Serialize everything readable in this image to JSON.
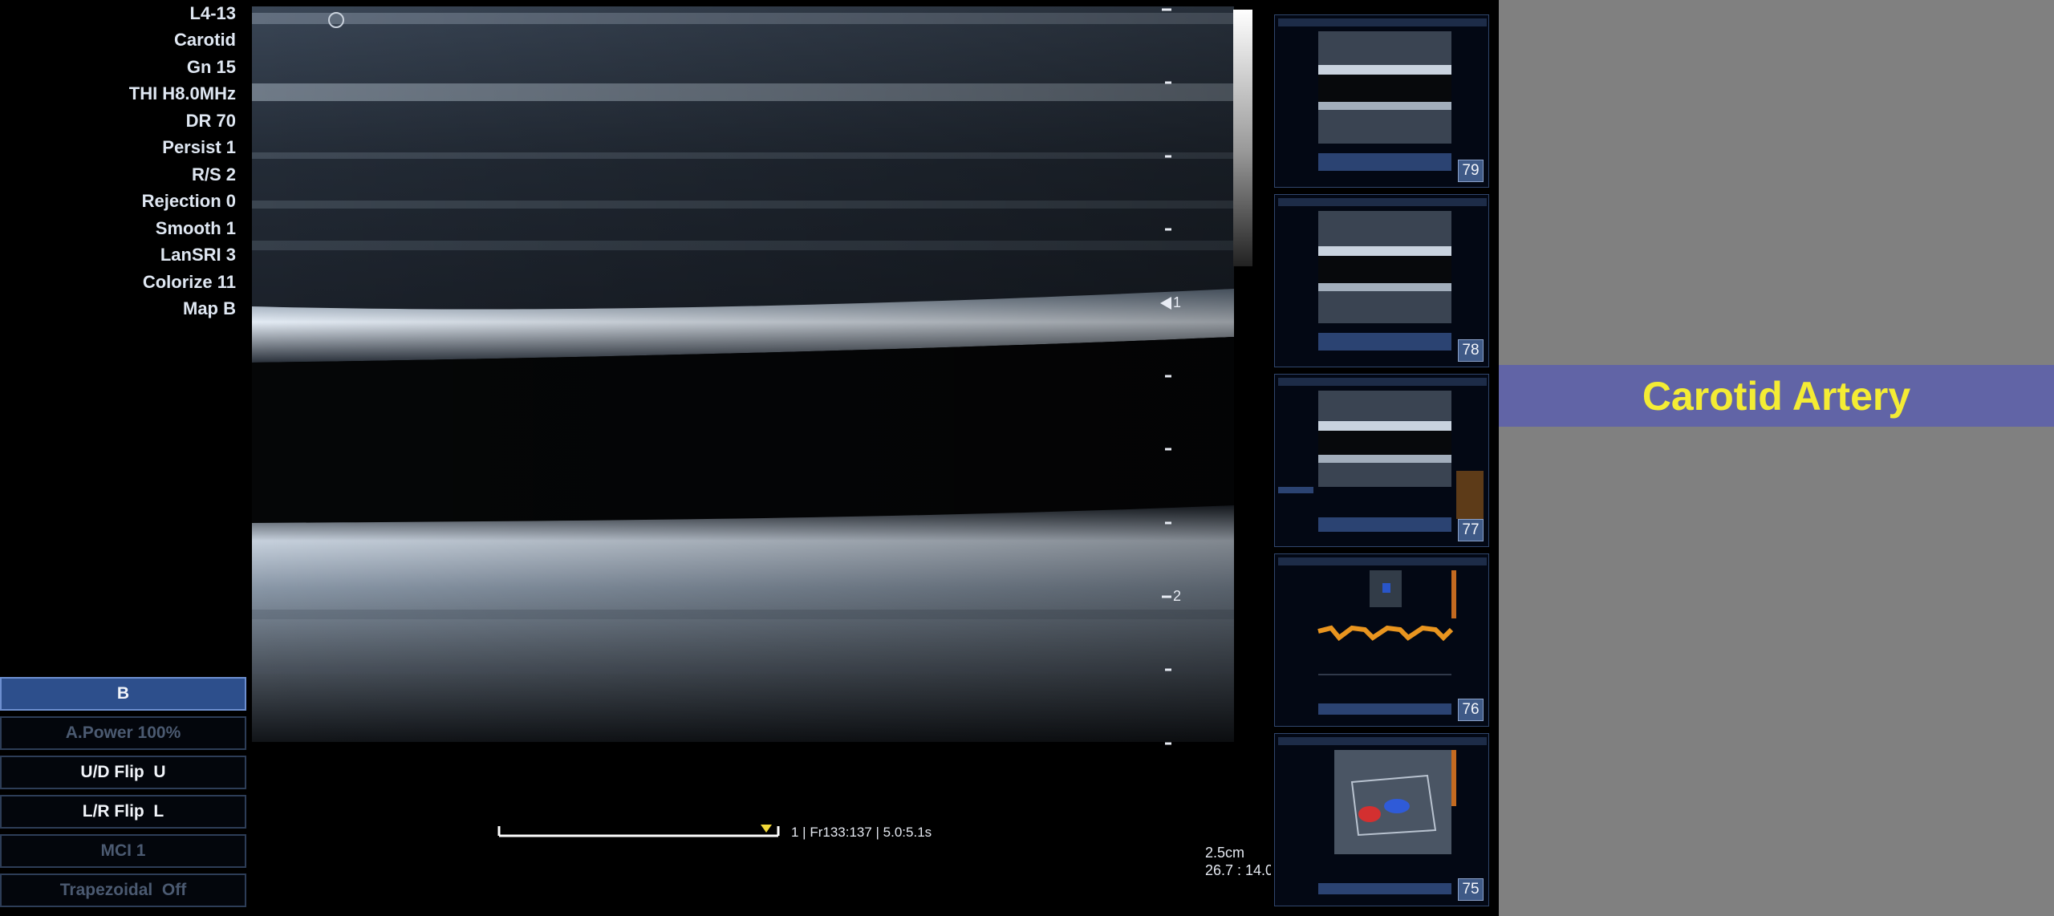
{
  "scan_params": [
    "L4-13",
    "Carotid",
    "Gn 15",
    "THI H8.0MHz",
    "DR 70",
    "Persist 1",
    "R/S 2",
    "Rejection 0",
    "Smooth 1",
    "LanSRI 3",
    "Colorize 11",
    "Map B"
  ],
  "controls": [
    {
      "label": "B",
      "state": "active"
    },
    {
      "label": "A.Power 100%",
      "state": "disabled"
    },
    {
      "label": "U/D Flip  U",
      "state": "enabled"
    },
    {
      "label": "L/R Flip  L",
      "state": "enabled"
    },
    {
      "label": "MCI 1",
      "state": "disabled"
    },
    {
      "label": "Trapezoidal  Off",
      "state": "disabled"
    }
  ],
  "depth_scale": {
    "focus_marker": "1",
    "label_2": "2"
  },
  "cine": {
    "info": "1 | Fr133:137 | 5.0:5.1s"
  },
  "measurement": {
    "depth": "2.5cm",
    "ratio": "26.7 : 14.0"
  },
  "thumbnails": [
    {
      "number": "79",
      "type": "bmode"
    },
    {
      "number": "78",
      "type": "bmode"
    },
    {
      "number": "77",
      "type": "bmode-curve"
    },
    {
      "number": "76",
      "type": "doppler"
    },
    {
      "number": "75",
      "type": "color"
    }
  ],
  "colors": {
    "title_bg": "#6164a6",
    "title_text": "#f4ec34",
    "side_panel": "#808080"
  },
  "title": "Carotid Artery"
}
